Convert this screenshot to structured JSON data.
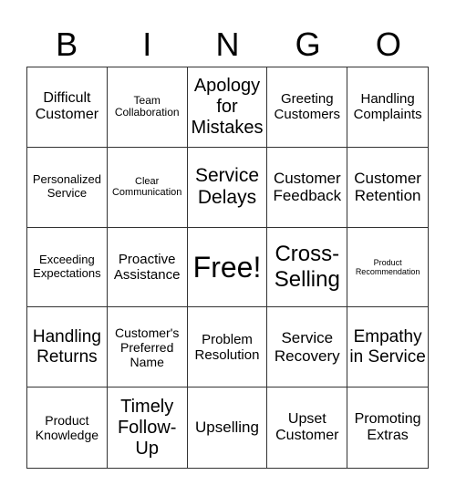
{
  "header": {
    "letters": [
      "B",
      "I",
      "N",
      "G",
      "O"
    ]
  },
  "board": {
    "rows": [
      [
        "Difficult Customer",
        "Team Collaboration",
        "Apology for Mistakes",
        "Greeting Customers",
        "Handling Complaints"
      ],
      [
        "Personalized Service",
        "Clear Communication",
        "Service Delays",
        "Customer Feedback",
        "Customer Retention"
      ],
      [
        "Exceeding Expectations",
        "Proactive Assistance",
        "Free!",
        "Cross-Selling",
        "Product Recommendation"
      ],
      [
        "Handling Returns",
        "Customer's Preferred Name",
        "Problem Resolution",
        "Service Recovery",
        "Empathy in Service"
      ],
      [
        "Product Knowledge",
        "Timely Follow-Up",
        "Upselling",
        "Upset Customer",
        "Promoting Extras"
      ]
    ],
    "free_space": "Free!"
  },
  "colors": {
    "grid_line": "#333333",
    "text": "#000000",
    "background": "#ffffff"
  }
}
